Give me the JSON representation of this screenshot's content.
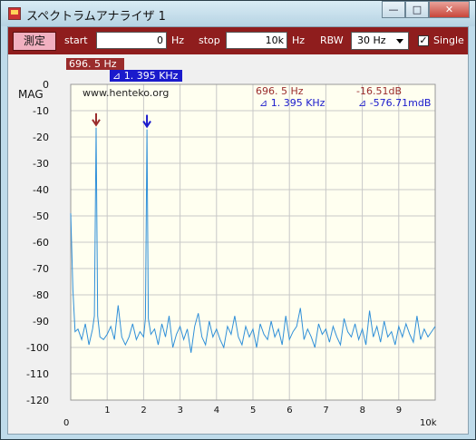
{
  "window": {
    "title": "スペクトラムアナライザ 1",
    "min_label": "—",
    "max_label": "□",
    "close_label": "✕"
  },
  "toolbar": {
    "measure_label": "測定",
    "start_label": "start",
    "start_value": "0",
    "start_unit": "Hz",
    "stop_label": "stop",
    "stop_value": "10k",
    "stop_unit": "Hz",
    "rbw_label": "RBW",
    "rbw_value": "30 Hz",
    "single_label": "Single",
    "single_checked": true
  },
  "plot": {
    "mag_label": "MAG",
    "marker1_tag": "696. 5 Hz",
    "marker2_tag": "⊿ 1. 395 KHz",
    "watermark": "www.henteko.org",
    "readout_m1_freq": "696. 5 Hz",
    "readout_m1_level": "-16.51dB",
    "readout_m2_freq": "⊿ 1. 395 KHz",
    "readout_m2_level": "⊿ -576.71mdB",
    "x_start_label": "0",
    "x_end_label": "10k",
    "colors": {
      "trace": "#2f8fd8",
      "marker1": "#9a2c2c",
      "marker2": "#1a1acc",
      "plot_bg": "#fffff0",
      "grid": "#c8c8c8"
    }
  },
  "chart_data": {
    "type": "line",
    "ylabel": "MAG",
    "xlim": [
      0,
      10000
    ],
    "ylim": [
      -120,
      0
    ],
    "x_tick_labels": [
      "0",
      "1",
      "2",
      "3",
      "4",
      "5",
      "6",
      "7",
      "8",
      "9",
      "10k"
    ],
    "y_tick_labels": [
      "0",
      "-10",
      "-20",
      "-30",
      "-40",
      "-50",
      "-60",
      "-70",
      "-80",
      "-90",
      "-100",
      "-110",
      "-120"
    ],
    "noise_floor_db": -95,
    "series": [
      {
        "points": [
          [
            0,
            -49
          ],
          [
            60,
            -78
          ],
          [
            120,
            -94
          ],
          [
            200,
            -93
          ],
          [
            300,
            -97
          ],
          [
            400,
            -91
          ],
          [
            500,
            -99
          ],
          [
            600,
            -93
          ],
          [
            650,
            -88
          ],
          [
            696.5,
            -16.5
          ],
          [
            740,
            -88
          ],
          [
            800,
            -96
          ],
          [
            900,
            -97
          ],
          [
            1000,
            -95
          ],
          [
            1100,
            -92
          ],
          [
            1200,
            -97
          ],
          [
            1300,
            -84
          ],
          [
            1400,
            -96
          ],
          [
            1500,
            -99
          ],
          [
            1600,
            -96
          ],
          [
            1700,
            -91
          ],
          [
            1800,
            -97
          ],
          [
            1900,
            -94
          ],
          [
            2000,
            -96
          ],
          [
            2050,
            -89
          ],
          [
            2091.5,
            -17.1
          ],
          [
            2130,
            -89
          ],
          [
            2200,
            -95
          ],
          [
            2300,
            -93
          ],
          [
            2400,
            -99
          ],
          [
            2500,
            -91
          ],
          [
            2600,
            -96
          ],
          [
            2700,
            -88
          ],
          [
            2800,
            -100
          ],
          [
            2900,
            -95
          ],
          [
            3000,
            -92
          ],
          [
            3100,
            -97
          ],
          [
            3200,
            -93
          ],
          [
            3300,
            -102
          ],
          [
            3400,
            -92
          ],
          [
            3500,
            -87
          ],
          [
            3600,
            -96
          ],
          [
            3700,
            -99
          ],
          [
            3800,
            -90
          ],
          [
            3900,
            -96
          ],
          [
            4000,
            -93
          ],
          [
            4100,
            -97
          ],
          [
            4200,
            -100
          ],
          [
            4300,
            -92
          ],
          [
            4400,
            -95
          ],
          [
            4500,
            -88
          ],
          [
            4600,
            -96
          ],
          [
            4700,
            -99
          ],
          [
            4800,
            -92
          ],
          [
            4900,
            -96
          ],
          [
            5000,
            -93
          ],
          [
            5100,
            -100
          ],
          [
            5200,
            -91
          ],
          [
            5300,
            -95
          ],
          [
            5400,
            -97
          ],
          [
            5500,
            -90
          ],
          [
            5600,
            -96
          ],
          [
            5700,
            -93
          ],
          [
            5800,
            -99
          ],
          [
            5900,
            -88
          ],
          [
            6000,
            -97
          ],
          [
            6100,
            -94
          ],
          [
            6200,
            -92
          ],
          [
            6300,
            -85
          ],
          [
            6400,
            -97
          ],
          [
            6500,
            -93
          ],
          [
            6600,
            -96
          ],
          [
            6700,
            -100
          ],
          [
            6800,
            -91
          ],
          [
            6900,
            -95
          ],
          [
            7000,
            -93
          ],
          [
            7100,
            -98
          ],
          [
            7200,
            -92
          ],
          [
            7300,
            -96
          ],
          [
            7400,
            -99
          ],
          [
            7500,
            -89
          ],
          [
            7600,
            -94
          ],
          [
            7700,
            -96
          ],
          [
            7800,
            -91
          ],
          [
            7900,
            -97
          ],
          [
            8000,
            -93
          ],
          [
            8100,
            -99
          ],
          [
            8200,
            -86
          ],
          [
            8300,
            -96
          ],
          [
            8400,
            -92
          ],
          [
            8500,
            -98
          ],
          [
            8600,
            -90
          ],
          [
            8700,
            -96
          ],
          [
            8800,
            -94
          ],
          [
            8900,
            -99
          ],
          [
            9000,
            -92
          ],
          [
            9100,
            -96
          ],
          [
            9200,
            -91
          ],
          [
            9300,
            -95
          ],
          [
            9400,
            -98
          ],
          [
            9500,
            -88
          ],
          [
            9600,
            -97
          ],
          [
            9700,
            -93
          ],
          [
            9800,
            -96
          ],
          [
            9900,
            -94
          ],
          [
            10000,
            -92
          ]
        ]
      }
    ],
    "markers": [
      {
        "x": 696.5,
        "y": -16.5
      },
      {
        "x": 2091.5,
        "y": -17.1
      }
    ],
    "grid": true
  }
}
